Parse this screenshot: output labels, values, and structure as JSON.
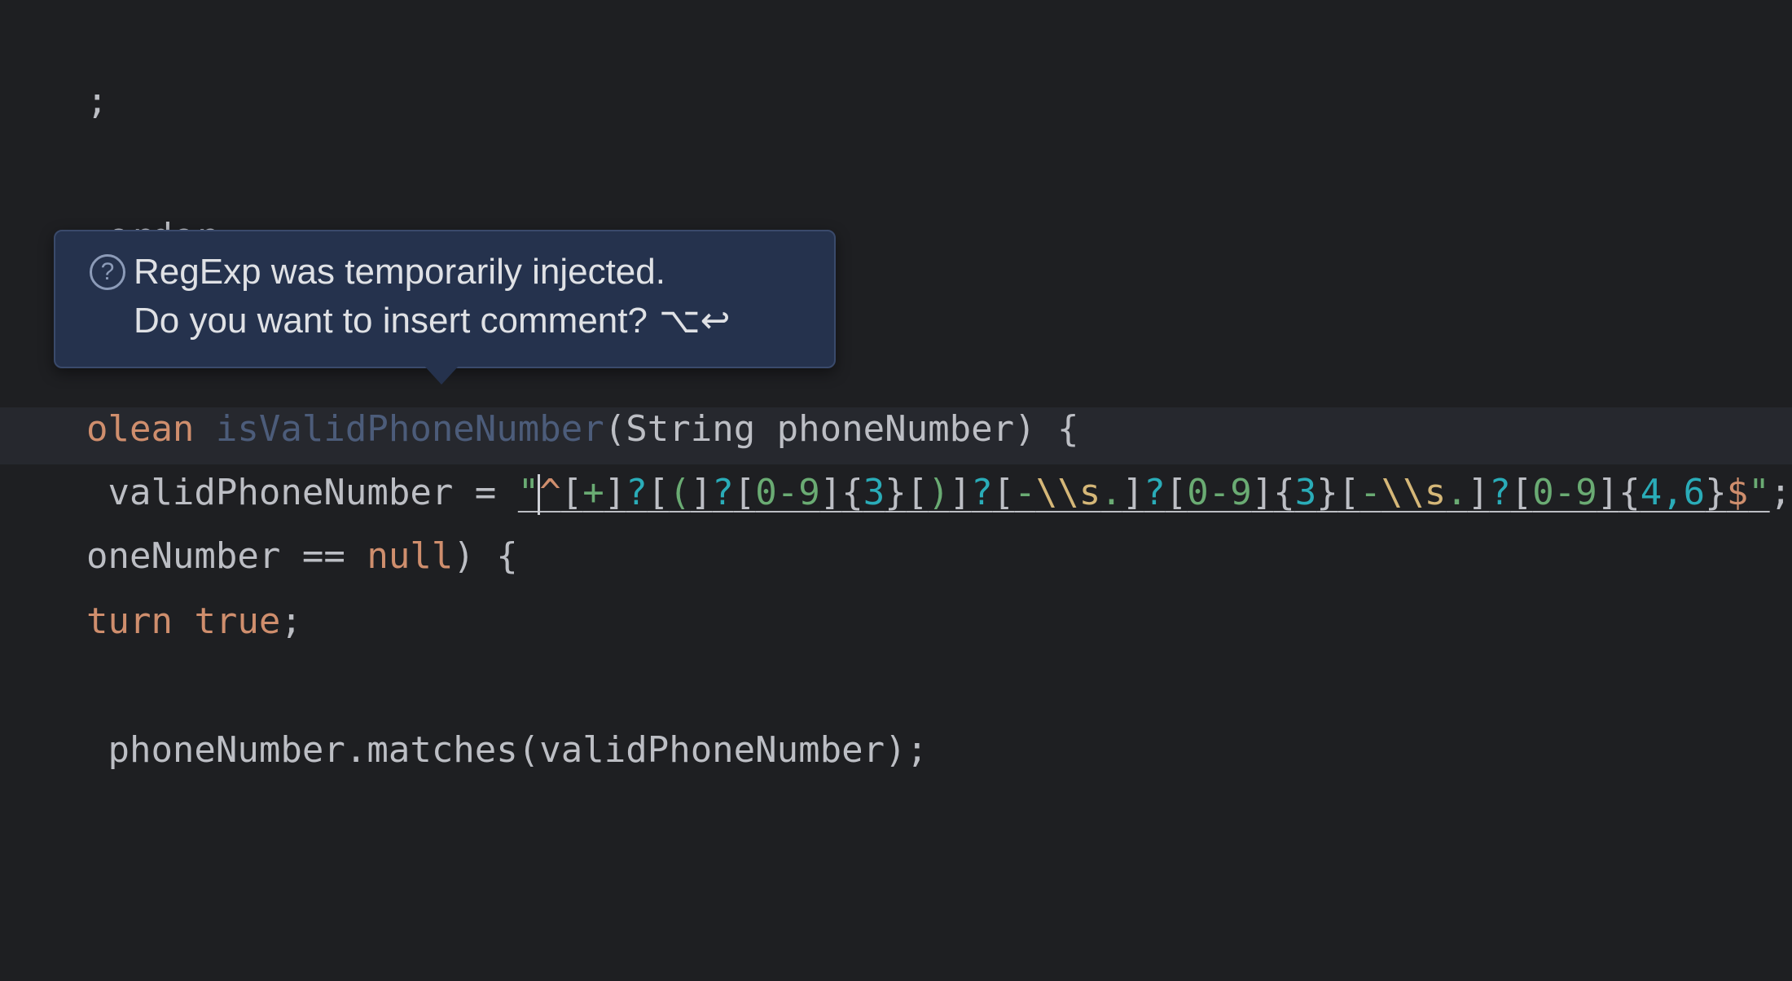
{
  "editor": {
    "lines": {
      "top_partial": ";",
      "order_line": " order;",
      "method_signature": {
        "kw": "olean",
        "name": " isValidPhoneNumber",
        "params": "(String phoneNumber) {"
      },
      "regex_line": {
        "prefix": " validPhoneNumber = ",
        "quote_open": "\"",
        "tokens": [
          {
            "t": "^",
            "c": "rx-anchor"
          },
          {
            "t": "[",
            "c": "rx-plain"
          },
          {
            "t": "+",
            "c": "rx-char"
          },
          {
            "t": "]",
            "c": "rx-plain"
          },
          {
            "t": "?",
            "c": "rx-op"
          },
          {
            "t": "[",
            "c": "rx-plain"
          },
          {
            "t": "(",
            "c": "rx-char"
          },
          {
            "t": "]",
            "c": "rx-plain"
          },
          {
            "t": "?",
            "c": "rx-op"
          },
          {
            "t": "[",
            "c": "rx-plain"
          },
          {
            "t": "0-9",
            "c": "rx-char"
          },
          {
            "t": "]",
            "c": "rx-plain"
          },
          {
            "t": "{",
            "c": "rx-plain"
          },
          {
            "t": "3",
            "c": "rx-quant"
          },
          {
            "t": "}",
            "c": "rx-plain"
          },
          {
            "t": "[",
            "c": "rx-plain"
          },
          {
            "t": ")",
            "c": "rx-char"
          },
          {
            "t": "]",
            "c": "rx-plain"
          },
          {
            "t": "?",
            "c": "rx-op"
          },
          {
            "t": "[",
            "c": "rx-plain"
          },
          {
            "t": "-",
            "c": "rx-char"
          },
          {
            "t": "\\\\s",
            "c": "rx-esc"
          },
          {
            "t": ".",
            "c": "rx-char"
          },
          {
            "t": "]",
            "c": "rx-plain"
          },
          {
            "t": "?",
            "c": "rx-op"
          },
          {
            "t": "[",
            "c": "rx-plain"
          },
          {
            "t": "0-9",
            "c": "rx-char"
          },
          {
            "t": "]",
            "c": "rx-plain"
          },
          {
            "t": "{",
            "c": "rx-plain"
          },
          {
            "t": "3",
            "c": "rx-quant"
          },
          {
            "t": "}",
            "c": "rx-plain"
          },
          {
            "t": "[",
            "c": "rx-plain"
          },
          {
            "t": "-",
            "c": "rx-char"
          },
          {
            "t": "\\\\s",
            "c": "rx-esc"
          },
          {
            "t": ".",
            "c": "rx-char"
          },
          {
            "t": "]",
            "c": "rx-plain"
          },
          {
            "t": "?",
            "c": "rx-op"
          },
          {
            "t": "[",
            "c": "rx-plain"
          },
          {
            "t": "0-9",
            "c": "rx-char"
          },
          {
            "t": "]",
            "c": "rx-plain"
          },
          {
            "t": "{",
            "c": "rx-plain"
          },
          {
            "t": "4,6",
            "c": "rx-quant"
          },
          {
            "t": "}",
            "c": "rx-plain"
          },
          {
            "t": "$",
            "c": "rx-anchor"
          }
        ],
        "quote_close": "\"",
        "suffix": ";"
      },
      "null_check": {
        "a": "oneNumber == ",
        "kw": "null",
        "b": ") {"
      },
      "return_true": {
        "kw1": "turn",
        "sp": " ",
        "kw2": "true",
        "b": ";"
      },
      "return_matches": " phoneNumber.matches(validPhoneNumber);"
    }
  },
  "tooltip": {
    "icon": "help-icon",
    "line1": "RegExp was temporarily injected.",
    "line2": "Do you want to insert comment?",
    "shortcut": "⌥↩"
  }
}
